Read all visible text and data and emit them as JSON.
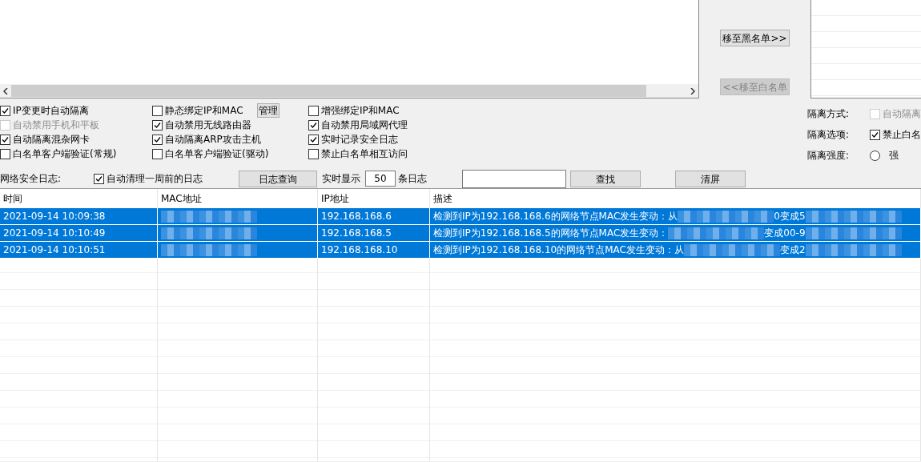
{
  "top": {
    "move_to_black": {
      "label": "移至黑名单>>",
      "disabled": false
    },
    "move_to_white": {
      "label": "<<移至白名单",
      "disabled": true
    }
  },
  "options": {
    "columns": [
      [
        {
          "label": "IP变更时自动隔离",
          "checked": true,
          "disabled": false
        },
        {
          "label": "自动禁用手机和平板",
          "checked": false,
          "disabled": true
        },
        {
          "label": "自动隔离混杂网卡",
          "checked": true,
          "disabled": false
        },
        {
          "label": "白名单客户端验证(常规)",
          "checked": false,
          "disabled": false
        }
      ],
      [
        {
          "label": "静态绑定IP和MAC",
          "checked": false,
          "disabled": false,
          "button": "管理"
        },
        {
          "label": "自动禁用无线路由器",
          "checked": true,
          "disabled": false
        },
        {
          "label": "自动隔离ARP攻击主机",
          "checked": true,
          "disabled": false
        },
        {
          "label": "白名单客户端验证(驱动)",
          "checked": false,
          "disabled": false
        }
      ],
      [
        {
          "label": "增强绑定IP和MAC",
          "checked": false,
          "disabled": false
        },
        {
          "label": "自动禁用局域网代理",
          "checked": true,
          "disabled": false
        },
        {
          "label": "实时记录安全日志",
          "checked": true,
          "disabled": false
        },
        {
          "label": "禁止白名单相互访问",
          "checked": false,
          "disabled": false
        }
      ]
    ],
    "isolation": [
      {
        "label": "隔离方式:",
        "kind": "checkbox",
        "option": "自动隔离",
        "checked": false,
        "disabled": true
      },
      {
        "label": "隔离选项:",
        "kind": "checkbox",
        "option": "禁止白名",
        "checked": true,
        "disabled": false
      },
      {
        "label": "隔离强度:",
        "kind": "radio",
        "option": "强",
        "checked": false
      }
    ]
  },
  "log_bar": {
    "label": "网络安全日志:",
    "auto_clean": {
      "label": "自动清理一周前的日志",
      "checked": true
    },
    "query_button": "日志查询",
    "realtime_prefix": "实时显示",
    "realtime_count": "50",
    "realtime_suffix": "条日志",
    "find_button": "查找",
    "clear_button": "清屏"
  },
  "table": {
    "columns": [
      "时间",
      "MAC地址",
      "IP地址",
      "描述"
    ],
    "rows": [
      {
        "time": "2021-09-14 10:09:38",
        "ip": "192.168.168.6",
        "desc_start": "检测到IP为192.168.168.6的网络节点MAC发生变动：从",
        "desc_middle": "0变成5",
        "selected": true
      },
      {
        "time": "2021-09-14 10:10:49",
        "ip": "192.168.168.5",
        "desc_start": "检测到IP为192.168.168.5的网络节点MAC发生变动：",
        "desc_middle": "变成00-9",
        "selected": true
      },
      {
        "time": "2021-09-14 10:10:51",
        "ip": "192.168.168.10",
        "desc_start": "检测到IP为192.168.168.10的网络节点MAC发生变动：从",
        "desc_middle": "变成2",
        "selected": true
      }
    ]
  }
}
